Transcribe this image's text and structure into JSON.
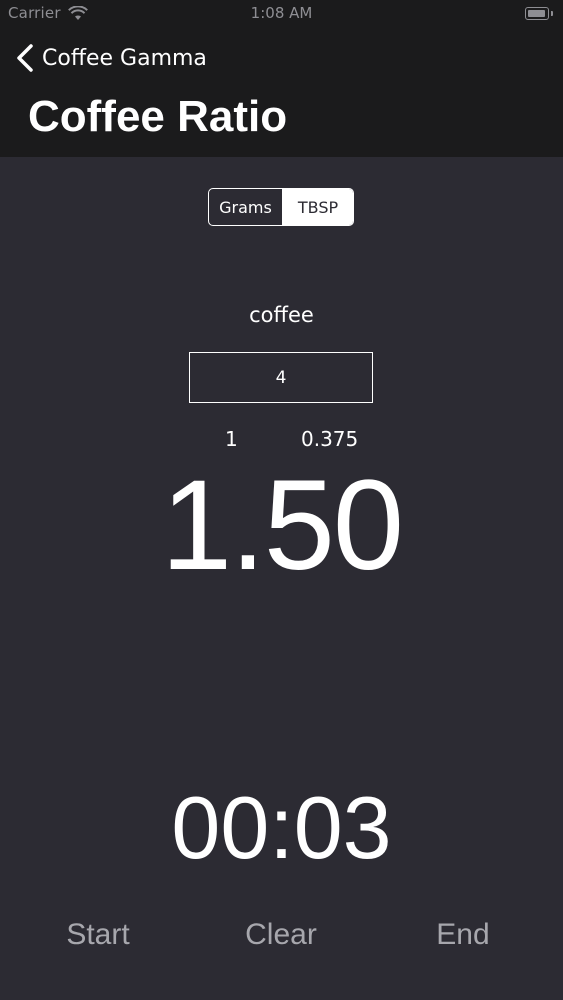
{
  "status_bar": {
    "carrier": "Carrier",
    "time": "1:08 AM"
  },
  "nav": {
    "back_label": "Coffee Gamma",
    "title": "Coffee Ratio"
  },
  "units": {
    "options": [
      "Grams",
      "TBSP"
    ],
    "selected": "TBSP"
  },
  "coffee": {
    "label": "coffee",
    "value": "4"
  },
  "ratio": {
    "left": "1",
    "right": "0.375"
  },
  "result": "1.50",
  "timer": "00:03",
  "controls": {
    "start": "Start",
    "clear": "Clear",
    "end": "End"
  },
  "colors": {
    "background": "#2c2b33",
    "topbar": "#1b1b1c",
    "text": "#ffffff",
    "muted": "#a7a7ad"
  }
}
